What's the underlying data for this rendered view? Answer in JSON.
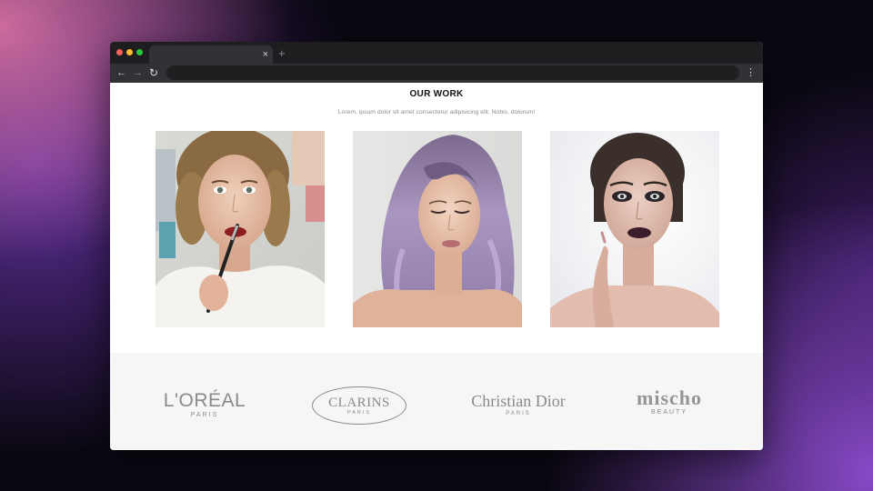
{
  "browser": {
    "tab_close_icon": "×",
    "new_tab_icon": "+",
    "back_icon": "←",
    "forward_icon": "→",
    "reload_icon": "↻",
    "menu_icon": "⋮",
    "address": ""
  },
  "section": {
    "title": "OUR WORK",
    "subtitle": "Lorem, ipsum dolor sit amet consectetur adipisicing elit. Nobis, dolorum!"
  },
  "portfolio": [
    {
      "name": "portfolio-photo-lipstick"
    },
    {
      "name": "portfolio-photo-lavender-hair"
    },
    {
      "name": "portfolio-photo-dark-lips"
    }
  ],
  "brands": [
    {
      "name": "L'ORÉAL",
      "sub": "PARIS"
    },
    {
      "name": "CLARINS",
      "sub": "PARIS"
    },
    {
      "name": "Christian Dior",
      "sub": "PARIS"
    },
    {
      "name": "mischo",
      "sub": "BEAUTY"
    }
  ],
  "colors": {
    "window_chrome": "#1e1e21",
    "toolbar": "#323236",
    "logo_strip": "#f6f6f6",
    "logo_gray": "#8a8a8a",
    "title": "#111111"
  }
}
